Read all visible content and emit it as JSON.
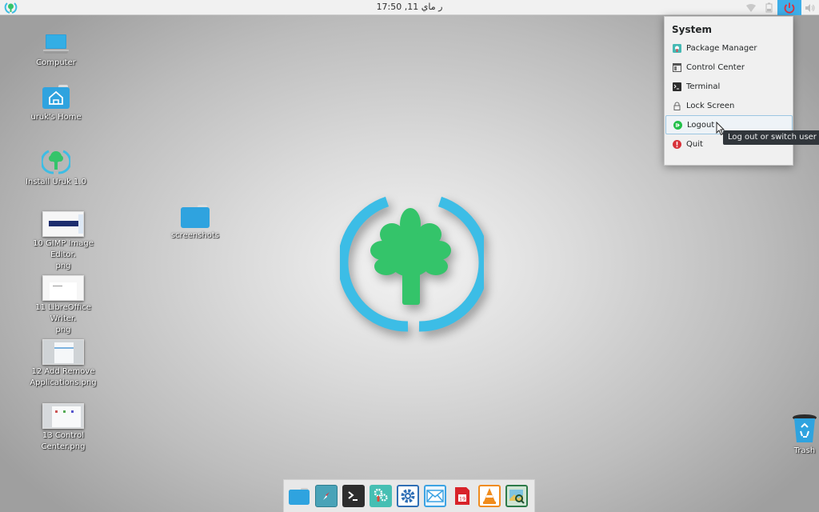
{
  "top_panel": {
    "clock": "ر ماي 11, 17:50",
    "tray": [
      {
        "name": "wifi-icon",
        "label": "Network"
      },
      {
        "name": "battery-icon",
        "label": "Battery"
      },
      {
        "name": "power-icon",
        "label": "System",
        "active": true
      },
      {
        "name": "volume-icon",
        "label": "Volume"
      }
    ],
    "accent_color": "#3daee9"
  },
  "desktop": {
    "icons": [
      {
        "label": "Computer",
        "icon": "computer-icon"
      },
      {
        "label": "uruk's Home",
        "icon": "home-folder-icon"
      },
      {
        "label": "Install Uruk 1.0",
        "icon": "installer-icon"
      },
      {
        "label": "10 GIMP Image Editor.\npng",
        "line1": "10 GIMP Image Editor.",
        "line2": "png",
        "icon": "image-thumbnail-icon"
      },
      {
        "label": "11 LibreOffice Writer.\npng",
        "line1": "11 LibreOffice Writer.",
        "line2": "png",
        "icon": "image-thumbnail-icon"
      },
      {
        "label": "12 Add Remove Applications.png",
        "line1": "12 Add Remove",
        "line2": "Applications.png",
        "icon": "image-thumbnail-icon"
      },
      {
        "label": "13 Control Center.png",
        "icon": "image-thumbnail-icon"
      },
      {
        "label": "screenshots",
        "icon": "folder-icon"
      },
      {
        "label": "Trash",
        "icon": "trash-icon"
      }
    ]
  },
  "system_menu": {
    "title": "System",
    "items": [
      {
        "label": "Package Manager",
        "icon": "package-manager-icon"
      },
      {
        "label": "Control Center",
        "icon": "control-center-icon"
      },
      {
        "label": "Terminal",
        "icon": "terminal-icon"
      },
      {
        "label": "Lock Screen",
        "icon": "lock-icon"
      },
      {
        "label": "Logout",
        "icon": "logout-icon",
        "hovered": true
      },
      {
        "label": "Quit",
        "icon": "quit-icon"
      }
    ],
    "tooltip": "Log out or switch user"
  },
  "dock": {
    "items": [
      {
        "name": "file-manager",
        "icon": "folder-icon",
        "running": true
      },
      {
        "name": "web-browser",
        "icon": "compass-icon"
      },
      {
        "name": "terminal",
        "icon": "terminal-icon",
        "running": true
      },
      {
        "name": "system-settings",
        "icon": "gears-icon"
      },
      {
        "name": "control-center",
        "icon": "gear-icon"
      },
      {
        "name": "mail-client",
        "icon": "mail-icon"
      },
      {
        "name": "calendar",
        "icon": "calendar-icon",
        "calendar_day": "19"
      },
      {
        "name": "vlc-media-player",
        "icon": "vlc-icon"
      },
      {
        "name": "image-viewer",
        "icon": "image-viewer-icon"
      }
    ]
  }
}
